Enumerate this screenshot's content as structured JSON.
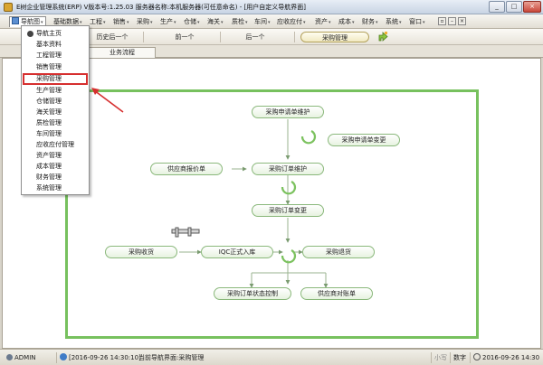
{
  "window": {
    "title": "E树企业管理系统(ERP) V版本号:1.25.03  服务器名称:本机服务器(可任意命名) - [用户自定义导航界面]",
    "minimize": "_",
    "maximize": "□",
    "close": "×"
  },
  "menubar": {
    "items": [
      {
        "label": "导航图",
        "arrow": "▾"
      },
      {
        "label": "基础数据",
        "arrow": "▾"
      },
      {
        "label": "工程",
        "arrow": "▾"
      },
      {
        "label": "销售",
        "arrow": "▾"
      },
      {
        "label": "采购",
        "arrow": "▾"
      },
      {
        "label": "生产",
        "arrow": "▾"
      },
      {
        "label": "仓储",
        "arrow": "▾"
      },
      {
        "label": "海关",
        "arrow": "▾"
      },
      {
        "label": "质检",
        "arrow": "▾"
      },
      {
        "label": "车间",
        "arrow": "▾"
      },
      {
        "label": "应收应付",
        "arrow": "▾"
      },
      {
        "label": "资产",
        "arrow": "▾"
      },
      {
        "label": "成本",
        "arrow": "▾"
      },
      {
        "label": "财务",
        "arrow": "▾"
      },
      {
        "label": "系统",
        "arrow": "▾"
      },
      {
        "label": "窗口",
        "arrow": "▾"
      }
    ],
    "icons": [
      "restore-icon",
      "minimize-icon",
      "close-icon"
    ]
  },
  "toolbar": {
    "back_label": "历史后一个",
    "prev_label": "前一个",
    "next_label": "后一个",
    "current_label": "采购管理"
  },
  "tabs": [
    {
      "label": "业务流程"
    }
  ],
  "dropdown": {
    "items": [
      {
        "label": "导航主页",
        "checked": true
      },
      {
        "label": "基本资料"
      },
      {
        "label": "工程管理"
      },
      {
        "label": "销售管理"
      },
      {
        "label": "采购管理",
        "highlighted": true
      },
      {
        "label": "生产管理"
      },
      {
        "label": "仓储管理"
      },
      {
        "label": "海关管理"
      },
      {
        "label": "质检管理"
      },
      {
        "label": "车间管理"
      },
      {
        "label": "应收应付管理"
      },
      {
        "label": "资产管理"
      },
      {
        "label": "成本管理"
      },
      {
        "label": "财务管理"
      },
      {
        "label": "系统管理"
      }
    ]
  },
  "flow": {
    "nodes": {
      "request_maintain": "采购申请单维护",
      "request_change": "采购申请单变更",
      "supplier_quote": "供应商报价单",
      "order_maintain": "采购订单维护",
      "order_change": "采购订单变更",
      "receive": "采购收货",
      "iqc": "IQC正式入库",
      "return": "采购退货",
      "order_status": "采购订单状态控制",
      "supplier_recon": "供应商对账单"
    }
  },
  "statusbar": {
    "user": "ADMIN",
    "time_left": "[2016-09-26 14:30:10]",
    "current_nav": "当前导航界面:采购管理",
    "small_caps": "小写",
    "num_lock": "数字",
    "time_right": "2016-09-26 14:30"
  },
  "colors": {
    "flow_border": "#77c15e",
    "annotation": "#d62f2f"
  }
}
